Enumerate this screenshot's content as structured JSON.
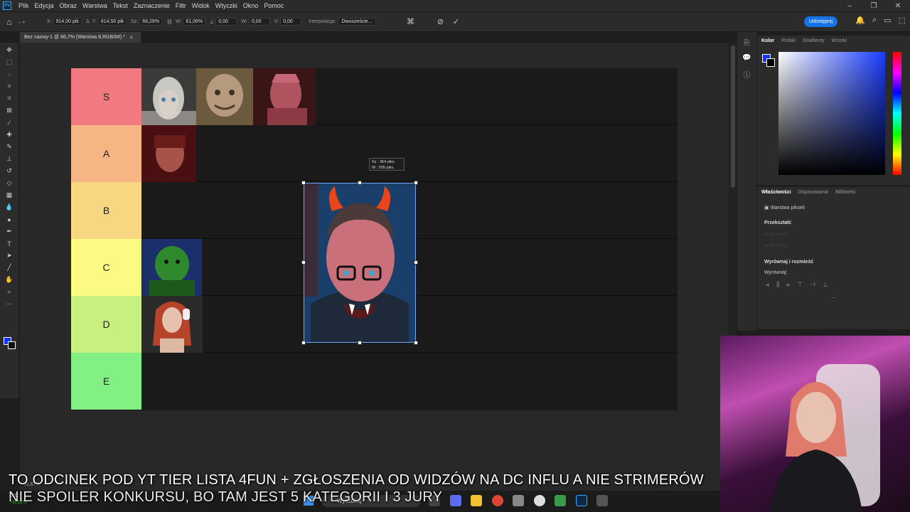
{
  "app": {
    "menu": [
      "Plik",
      "Edycja",
      "Obraz",
      "Warstwa",
      "Tekst",
      "Zaznaczenie",
      "Filtr",
      "Widok",
      "Wtyczki",
      "Okno",
      "Pomoc"
    ],
    "window_controls": [
      "–",
      "❐",
      "✕"
    ]
  },
  "options": {
    "x_label": "X:",
    "x_value": "914,00 pik",
    "y_label": "Y:",
    "y_value": "614,50 pik",
    "w_label": "Sz:",
    "w_value": "66,29%",
    "h_label": "W:",
    "h_value": "61,06%",
    "angle_label": "∠",
    "angle_value": "0,00",
    "hskew_label": "W:",
    "hskew_value": "0,00",
    "vskew_label": "V:",
    "vskew_value": "0,00",
    "interp_label": "Interpolacja:",
    "interp_value": "Dwuszeście...",
    "share_label": "Udostępnij"
  },
  "document": {
    "tab_title": "Bez nazwy-1 @ 66,7% (Warstwa 8,RGB/8#) *",
    "zoom_status": "66,67%"
  },
  "tiers": [
    {
      "label": "S",
      "color": "#f07a80"
    },
    {
      "label": "A",
      "color": "#f5b683"
    },
    {
      "label": "B",
      "color": "#f8d682"
    },
    {
      "label": "C",
      "color": "#fbfb84"
    },
    {
      "label": "D",
      "color": "#c8f080"
    },
    {
      "label": "E",
      "color": "#82f082"
    }
  ],
  "transform_tip": {
    "width_line": "Sz : 354 piks.",
    "height_line": "W : 505 piks."
  },
  "color_panel": {
    "tabs": [
      "Kolor",
      "Próbki",
      "Gradienty",
      "Wzorki"
    ],
    "fg_color": "#1433ff",
    "bg_color": "#000000"
  },
  "props_panel": {
    "tabs": [
      "Właściwości",
      "Dopasowania",
      "Biblioteki"
    ],
    "layer_type": "Warstwa pikseli",
    "transform_header": "Przekształć",
    "align_header": "Wyrównaj i rozmieść",
    "align_label": "Wyrównaj:",
    "more": "..."
  },
  "taskbar": {
    "temp": "6°C",
    "weather_change": "+0,32%",
    "search_placeholder": "Wyszukaj"
  },
  "captions": {
    "line1": "TO ODCINEK POD YT TIER LISTA 4FUN + ZGŁOSZENIA OD WIDZÓW NA DC INFLU A NIE STRIMERÓW",
    "line2": "NIE SPOILER KONKURSU, BO TAM JEST 5 KATEGORII I 3 JURY"
  }
}
